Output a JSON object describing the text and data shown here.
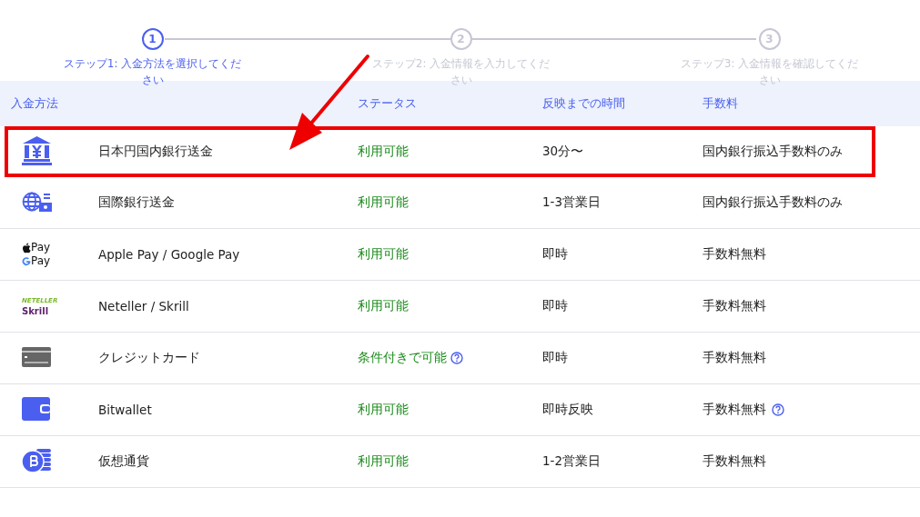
{
  "steps": [
    {
      "number": "1",
      "label": "ステップ1: 入金方法を選択してください",
      "selected": true
    },
    {
      "number": "2",
      "label": "ステップ2: 入金情報を入力してください",
      "selected": false
    },
    {
      "number": "3",
      "label": "ステップ3: 入金情報を確認してください",
      "selected": false
    }
  ],
  "table": {
    "columns": [
      "入金方法",
      "ステータス",
      "反映までの時間",
      "手数料"
    ],
    "rows": [
      {
        "kind": "bank",
        "name": "日本円国内銀行送金",
        "status": "利用可能",
        "time": "30分〜",
        "fee": "国内銀行振込手数料のみ",
        "highlighted": true
      },
      {
        "kind": "globe",
        "name": "国際銀行送金",
        "status": "利用可能",
        "time": "1-3営業日",
        "fee": "国内銀行振込手数料のみ",
        "highlighted": false
      },
      {
        "kind": "pay",
        "logo_lines": [
          "Pay",
          "Pay"
        ],
        "name": "Apple Pay / Google Pay",
        "status": "利用可能",
        "time": "即時",
        "fee": "手数料無料",
        "highlighted": false
      },
      {
        "kind": "neteller",
        "logo_lines": [
          "NETELLER",
          "Skrill"
        ],
        "name": "Neteller / Skrill",
        "status": "利用可能",
        "time": "即時",
        "fee": "手数料無料",
        "highlighted": false
      },
      {
        "kind": "card",
        "name": "クレジットカード",
        "status": "条件付きで可能",
        "status_help": true,
        "time": "即時",
        "fee": "手数料無料",
        "highlighted": false
      },
      {
        "kind": "wallet",
        "name": "Bitwallet",
        "status": "利用可能",
        "time": "即時反映",
        "fee": "手数料無料",
        "fee_help": true,
        "highlighted": false
      },
      {
        "kind": "crypto",
        "name": "仮想通貨",
        "status": "利用可能",
        "time": "1-2営業日",
        "fee": "手数料無料",
        "highlighted": false
      }
    ]
  }
}
